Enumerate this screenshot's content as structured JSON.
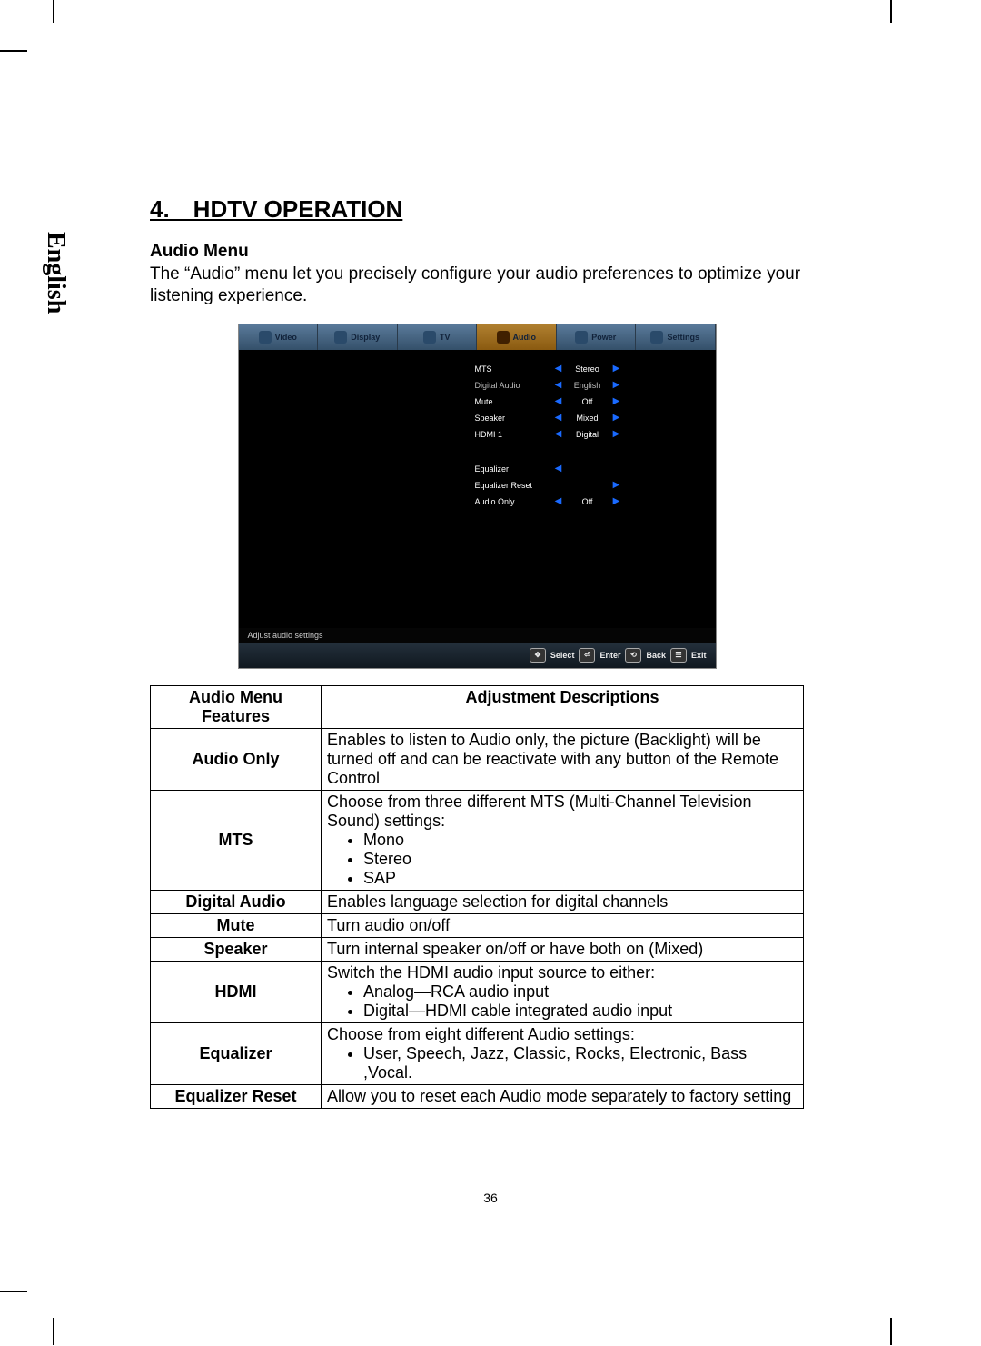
{
  "language_tab": "English",
  "section_title": "4. HDTV OPERATION",
  "subheading": "Audio Menu",
  "intro": "The “Audio” menu let you precisely configure your audio preferences to optimize your listening experience.",
  "osd": {
    "tabs": [
      "Video",
      "Display",
      "TV",
      "Audio",
      "Power",
      "Settings"
    ],
    "active_tab_index": 3,
    "rows": [
      {
        "label": "MTS",
        "value": "Stereo",
        "left": true,
        "right": true,
        "on": true
      },
      {
        "label": "Digital Audio",
        "value": "English",
        "left": true,
        "right": true,
        "on": false
      },
      {
        "label": "Mute",
        "value": "Off",
        "left": true,
        "right": true,
        "on": true
      },
      {
        "label": "Speaker",
        "value": "Mixed",
        "left": true,
        "right": true,
        "on": true
      },
      {
        "label": "HDMI 1",
        "value": "Digital",
        "left": true,
        "right": true,
        "on": true
      }
    ],
    "rows2": [
      {
        "label": "Equalizer",
        "value": "",
        "left": true,
        "right": false,
        "on": true
      },
      {
        "label": "Equalizer Reset",
        "value": "",
        "left": false,
        "right": true,
        "on": true
      },
      {
        "label": "Audio Only",
        "value": "Off",
        "left": true,
        "right": true,
        "on": true
      }
    ],
    "hint": "Adjust audio settings",
    "footer": {
      "select": "Select",
      "enter": "Enter",
      "back": "Back",
      "exit": "Exit"
    }
  },
  "table": {
    "head_feature": "Audio Menu Features",
    "head_desc": "Adjustment Descriptions",
    "rows": [
      {
        "feature": "Audio Only",
        "desc": "Enables to listen to Audio only, the  picture (Backlight) will be turned off and can be reactivate with any button of the Remote Control"
      },
      {
        "feature": "MTS",
        "desc": "Choose from three different MTS (Multi-Channel Television Sound) settings:",
        "bullets": [
          "Mono",
          "Stereo",
          "SAP"
        ]
      },
      {
        "feature": "Digital Audio",
        "desc": "Enables language selection for digital channels"
      },
      {
        "feature": "Mute",
        "desc": "Turn audio on/off"
      },
      {
        "feature": "Speaker",
        "desc": "Turn internal speaker on/off or have both on (Mixed)"
      },
      {
        "feature": "HDMI",
        "desc": "Switch the HDMI audio input source to either:",
        "bullets": [
          "Analog—RCA audio input",
          "Digital—HDMI cable integrated audio input"
        ]
      },
      {
        "feature": "Equalizer",
        "desc": "Choose from eight  different Audio settings:",
        "bullets": [
          "User, Speech, Jazz, Classic, Rocks, Electronic, Bass ,Vocal."
        ]
      },
      {
        "feature": "Equalizer Reset",
        "desc": "Allow you to reset each Audio mode separately to factory  setting"
      }
    ]
  },
  "page_number": "36"
}
